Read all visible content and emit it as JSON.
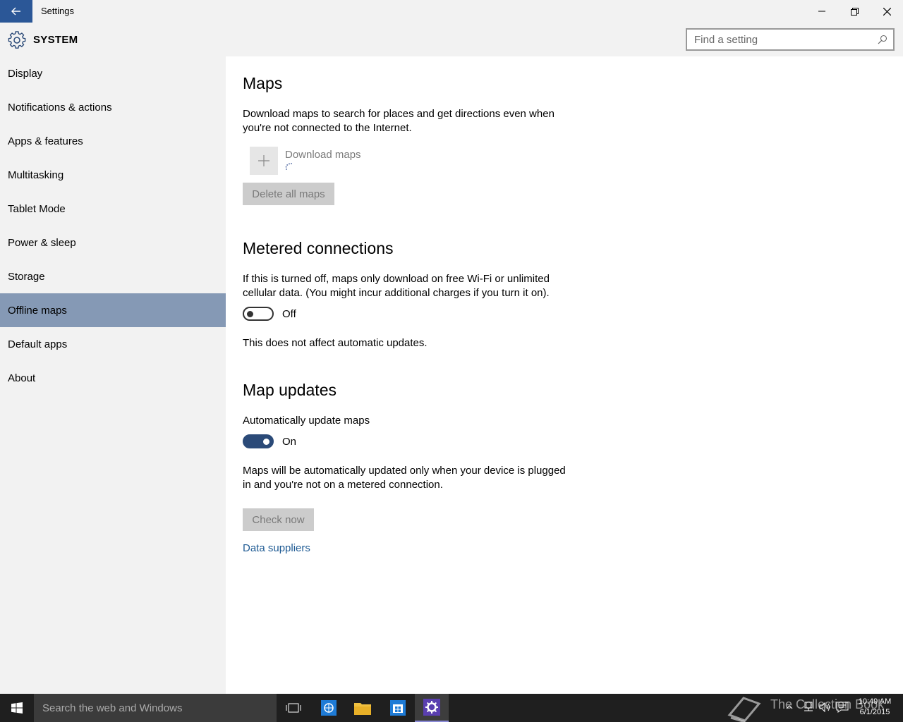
{
  "window": {
    "title": "Settings"
  },
  "header": {
    "section_title": "SYSTEM",
    "search_placeholder": "Find a setting"
  },
  "sidebar": {
    "items": [
      {
        "label": "Display"
      },
      {
        "label": "Notifications & actions"
      },
      {
        "label": "Apps & features"
      },
      {
        "label": "Multitasking"
      },
      {
        "label": "Tablet Mode"
      },
      {
        "label": "Power & sleep"
      },
      {
        "label": "Storage"
      },
      {
        "label": "Offline maps",
        "active": true
      },
      {
        "label": "Default apps"
      },
      {
        "label": "About"
      }
    ]
  },
  "content": {
    "maps": {
      "heading": "Maps",
      "description": "Download maps to search for places and get directions even when you're not connected to the Internet.",
      "download_label": "Download maps",
      "delete_button": "Delete all maps"
    },
    "metered": {
      "heading": "Metered connections",
      "description": "If this is turned off, maps only download on free Wi-Fi or unlimited cellular data. (You might incur additional charges if you turn it on).",
      "toggle_state": "Off",
      "note": "This does not affect automatic updates."
    },
    "updates": {
      "heading": "Map updates",
      "toggle_title": "Automatically update maps",
      "toggle_state": "On",
      "description": "Maps will be automatically updated only when your device is plugged in and you're not on a metered connection.",
      "check_button": "Check now",
      "data_link": "Data suppliers"
    }
  },
  "taskbar": {
    "search_text": "Search the web and Windows",
    "watermark": "The Collection Book",
    "time": "10:49 AM",
    "date": "6/1/2015"
  },
  "colors": {
    "accent": "#2b5797",
    "sidebar_active": "#8599b5",
    "toggle_on": "#2b4a78",
    "link": "#1e5a93"
  }
}
